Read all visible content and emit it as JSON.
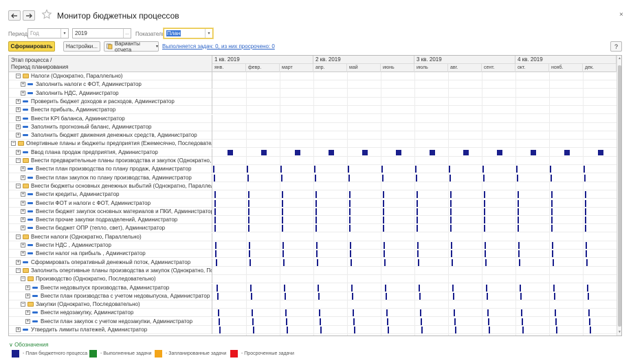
{
  "title": "Монитор бюджетных процессов",
  "close_glyph": "×",
  "filters": {
    "period_label": "Период:",
    "period_value": "Год",
    "year_value": "2019",
    "indicators_label": "Показатели:",
    "indicators_value": "План"
  },
  "toolbar": {
    "generate_label": "Сформировать",
    "settings_label": "Настройки...",
    "variants_label": "Варианты отчета",
    "status_link": "Выполняется задач: 0, из них просрочено: 0",
    "help_label": "?"
  },
  "grid": {
    "header_line1": "Этап процесса /",
    "header_line2": "Период планирования",
    "quarters": [
      "1 кв. 2019",
      "2 кв. 2019",
      "3 кв. 2019",
      "4 кв. 2019"
    ],
    "months": [
      "янв.",
      "февр.",
      "март",
      "апр.",
      "май",
      "июнь",
      "июль",
      "авг.",
      "сент.",
      "окт.",
      "нояб.",
      "дек."
    ],
    "rows": [
      {
        "level": 1,
        "toggle": "⊟",
        "icon": "folder",
        "text": "Налоги (Однократно, Параллельно)",
        "bars": "none"
      },
      {
        "level": 2,
        "toggle": "⊞",
        "icon": "task",
        "text": "Заполнить налоги с ФОТ, Администратор",
        "bars": "none"
      },
      {
        "level": 2,
        "toggle": "⊞",
        "icon": "task",
        "text": "Заполнить НДС, Администратор",
        "bars": "none"
      },
      {
        "level": 1,
        "toggle": "⊞",
        "icon": "task",
        "text": "Проверить бюджет доходов и расходов, Администратор",
        "bars": "none"
      },
      {
        "level": 1,
        "toggle": "⊞",
        "icon": "task",
        "text": "Внести прибыль, Администратор",
        "bars": "none"
      },
      {
        "level": 1,
        "toggle": "⊞",
        "icon": "task",
        "text": "Внести KPI баланса, Администратор",
        "bars": "none"
      },
      {
        "level": 1,
        "toggle": "⊞",
        "icon": "task",
        "text": "Заполнить прогнозный баланс, Администратор",
        "bars": "none"
      },
      {
        "level": 1,
        "toggle": "⊞",
        "icon": "task",
        "text": "Заполнить бюджет движения денежных средств, Администратор",
        "bars": "none"
      },
      {
        "level": 0,
        "toggle": "⊟",
        "icon": "folder",
        "text": "Опертивные планы и бюджеты предприятия (Ежемесячно, Последовательно)",
        "bars": "none"
      },
      {
        "level": 1,
        "toggle": "⊞",
        "icon": "task",
        "text": "Ввод плана продаж предприятия, Администратор",
        "bars": "block",
        "offset": 0.45
      },
      {
        "level": 1,
        "toggle": "⊟",
        "icon": "folder",
        "text": "Внести предварительные планы производства и закупок (Однократно, После...",
        "bars": "none"
      },
      {
        "level": 2,
        "toggle": "⊞",
        "icon": "task",
        "text": "Внести план производства по плану продаж, Администратор",
        "bars": "tick",
        "offset": 0.03
      },
      {
        "level": 2,
        "toggle": "⊞",
        "icon": "task",
        "text": "Внести план закупок по плану производства, Администратор",
        "bars": "tick",
        "offset": 0.05
      },
      {
        "level": 1,
        "toggle": "⊟",
        "icon": "folder",
        "text": "Внести бюджеты основных денежных выбытий (Однократно, Параллельно)",
        "bars": "none"
      },
      {
        "level": 2,
        "toggle": "⊞",
        "icon": "task",
        "text": "Внести кредиты, Администратор",
        "bars": "tick",
        "offset": 0.07
      },
      {
        "level": 2,
        "toggle": "⊞",
        "icon": "task",
        "text": "Внести ФОТ и налоги с ФОТ, Администратор",
        "bars": "tick",
        "offset": 0.07
      },
      {
        "level": 2,
        "toggle": "⊞",
        "icon": "task",
        "text": "Внести бюджет закупок основных материалов и ПКИ, Администратор",
        "bars": "tick",
        "offset": 0.07
      },
      {
        "level": 2,
        "toggle": "⊞",
        "icon": "task",
        "text": "Внести прочие закупки подразделений, Администратор",
        "bars": "tick",
        "offset": 0.07
      },
      {
        "level": 2,
        "toggle": "⊞",
        "icon": "task",
        "text": "Внести бюджет ОПР (тепло, свет), Администратор",
        "bars": "tick",
        "offset": 0.07
      },
      {
        "level": 1,
        "toggle": "⊟",
        "icon": "folder",
        "text": "Внести налоги (Однократно, Параллельно)",
        "bars": "none"
      },
      {
        "level": 2,
        "toggle": "⊞",
        "icon": "task",
        "text": "Внести НДС , Администратор",
        "bars": "tick",
        "offset": 0.09
      },
      {
        "level": 2,
        "toggle": "⊞",
        "icon": "task",
        "text": "Внести налог на прибыль , Администратор",
        "bars": "tick",
        "offset": 0.09
      },
      {
        "level": 1,
        "toggle": "⊞",
        "icon": "task",
        "text": "Сформировать оперативный денежный поток, Администратор",
        "bars": "tick",
        "offset": 0.11
      },
      {
        "level": 1,
        "toggle": "⊟",
        "icon": "folder",
        "text": "Заполнить опертивные планы производства и закупок (Однократно, Последо...",
        "bars": "none"
      },
      {
        "level": 2,
        "toggle": "⊟",
        "icon": "folder",
        "text": "Производство (Однократно, Последовательно)",
        "bars": "none"
      },
      {
        "level": 3,
        "toggle": "⊞",
        "icon": "task",
        "text": "Внести недовыпуск производства, Администратор",
        "bars": "tick",
        "offset": 0.13
      },
      {
        "level": 3,
        "toggle": "⊞",
        "icon": "task",
        "text": "Внести план производства с учетом недовыпуска, Администратор",
        "bars": "tick",
        "offset": 0.15
      },
      {
        "level": 2,
        "toggle": "⊟",
        "icon": "folder",
        "text": "Закупки (Однократно, Последовательно)",
        "bars": "none"
      },
      {
        "level": 3,
        "toggle": "⊞",
        "icon": "task",
        "text": "Внести недозакупку, Администратор",
        "bars": "tick",
        "offset": 0.17
      },
      {
        "level": 3,
        "toggle": "⊞",
        "icon": "task",
        "text": "Внести план закупок с учетом недозакупки, Администратор",
        "bars": "tick",
        "offset": 0.19
      },
      {
        "level": 1,
        "toggle": "⊞",
        "icon": "task",
        "text": "Утвердить лимиты платежей, Администратор",
        "bars": "tick",
        "offset": 0.21
      }
    ]
  },
  "legend": {
    "title": "Обозначения",
    "items": [
      {
        "color": "#1a1f8c",
        "text": "- План бюджетного процесса"
      },
      {
        "color": "#1f8a2c",
        "text": "- Выполненные задачи"
      },
      {
        "color": "#f3a51a",
        "text": "- Запланированные задачи"
      },
      {
        "color": "#e8141c",
        "text": "- Просроченные задачи"
      }
    ]
  }
}
